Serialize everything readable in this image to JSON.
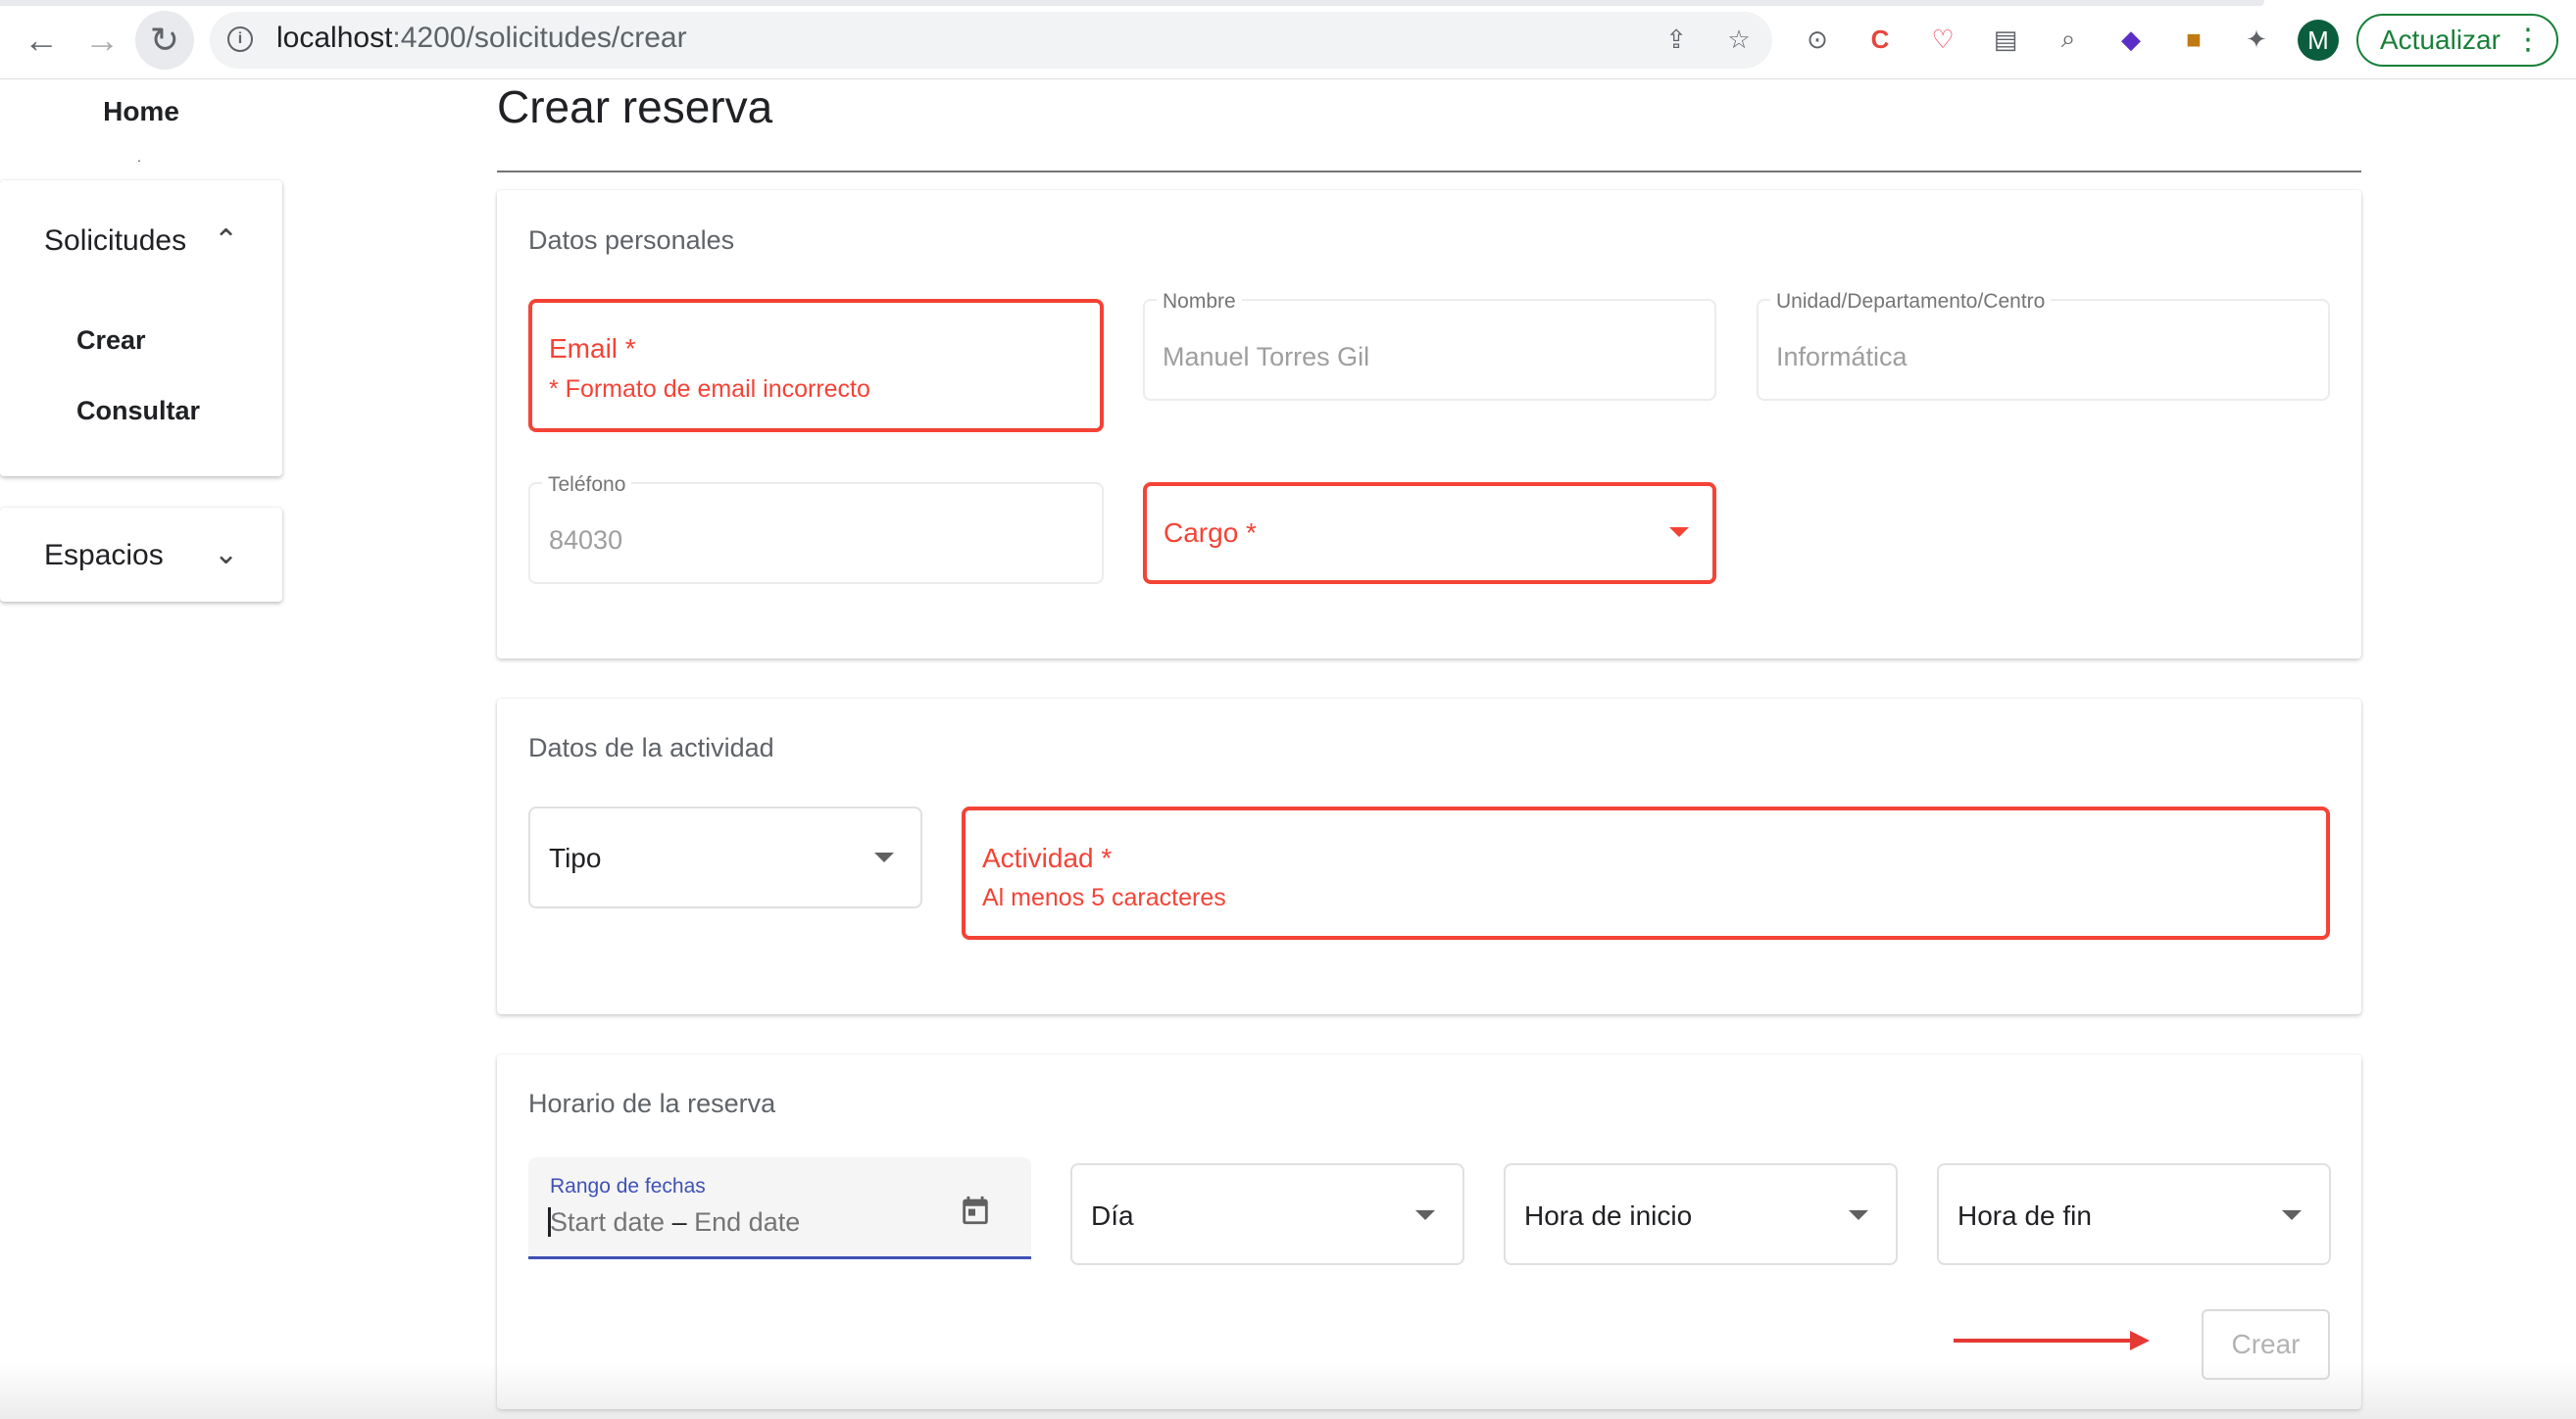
{
  "browser": {
    "url_host": "localhost",
    "url_path": ":4200/solicitudes/crear",
    "avatar_letter": "M",
    "update_label": "Actualizar",
    "more_label": "⋮"
  },
  "sidebar": {
    "home": "Home",
    "dot": ".",
    "solicitudes": {
      "title": "Solicitudes",
      "chevron": "⌃",
      "items": [
        "Crear",
        "Consultar"
      ]
    },
    "espacios": {
      "title": "Espacios",
      "chevron": "⌄"
    }
  },
  "page": {
    "title": "Crear reserva"
  },
  "personal": {
    "title": "Datos personales",
    "email": {
      "label": "Email *",
      "error": "* Formato de email incorrecto"
    },
    "nombre": {
      "label": "Nombre",
      "value": "Manuel Torres Gil"
    },
    "unidad": {
      "label": "Unidad/Departamento/Centro",
      "value": "Informática"
    },
    "telefono": {
      "label": "Teléfono",
      "value": "84030"
    },
    "cargo": {
      "label": "Cargo *"
    }
  },
  "activity": {
    "title": "Datos de la actividad",
    "tipo": {
      "label": "Tipo"
    },
    "actividad": {
      "label": "Actividad *",
      "error": "Al menos 5 caracteres"
    }
  },
  "schedule": {
    "title": "Horario de la reserva",
    "date_range": {
      "label": "Rango de fechas",
      "start": "Start date",
      "sep": "–",
      "end": "End date"
    },
    "dia": {
      "label": "Día"
    },
    "hora_inicio": {
      "label": "Hora de inicio"
    },
    "hora_fin": {
      "label": "Hora de fin"
    },
    "submit": "Crear"
  },
  "colors": {
    "error": "#f44336",
    "primary": "#3f51b5",
    "chrome_green": "#188038"
  }
}
